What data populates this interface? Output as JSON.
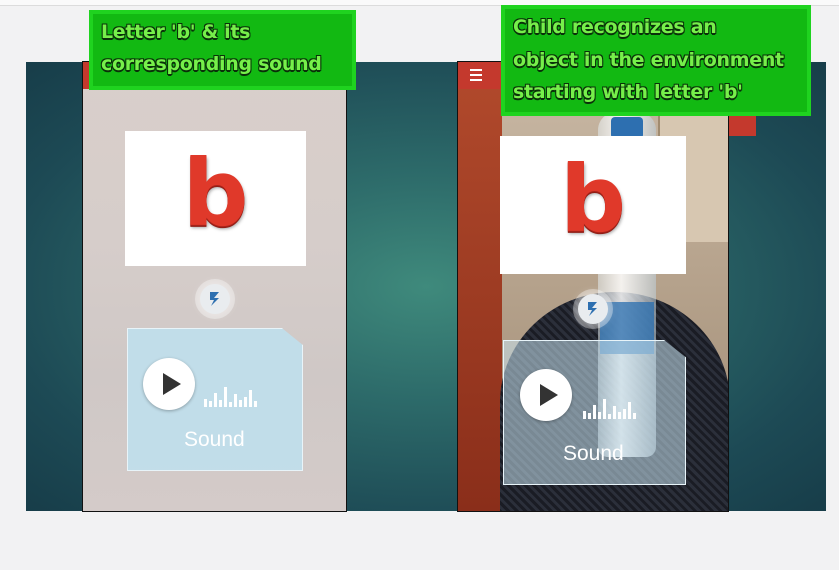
{
  "panels": {
    "left": {
      "callout": [
        "Letter 'b' & its",
        "corresponding sound"
      ],
      "card_letter": "b",
      "sound_label": "Sound"
    },
    "right": {
      "callout": [
        "Child recognizes an",
        "object in the environment",
        "starting with letter 'b'"
      ],
      "card_letter": "b",
      "sound_label": "Sound"
    }
  },
  "icons": {
    "menu": "menu-icon",
    "camera": "camera-icon",
    "eye": "eye-icon",
    "play": "play-icon",
    "badge": "app-badge-icon",
    "waveform": "waveform-icon"
  },
  "colors": {
    "app_bar": "#c4392d",
    "letter": "#e0392a",
    "callout_border": "#1fd31f",
    "callout_text": "#76f04a",
    "slide_bg": "#2d6b6a",
    "sound_card": "#bee1ee"
  },
  "waveform_levels": [
    0.4,
    0.25,
    0.7,
    0.35,
    0.9,
    0.2,
    0.6,
    0.3,
    0.5,
    0.75,
    0.25
  ]
}
